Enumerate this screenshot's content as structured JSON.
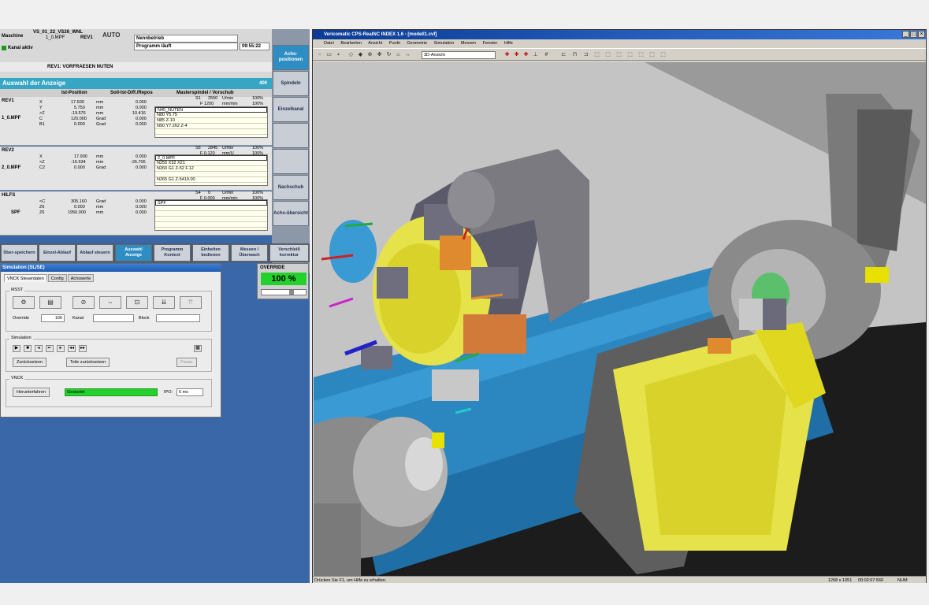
{
  "hmi": {
    "machine_label": "Maschine",
    "program_path": "VS_01_22_VS26_WNL",
    "program_file": "1_0.MPF",
    "channel": "REV1",
    "mode": "AUTO",
    "channel_state": "Kanal aktiv",
    "state_row1": "Nennbetrieb",
    "state_row2": "Programm läuft",
    "time": "09:55:22",
    "block_line": "REV1: VORFRAESEN NUTEN",
    "title": "Auswahl der Anzeige",
    "title_num": "400",
    "col_headers": [
      "Ist-Position",
      "Soll-Ist-Diff./Repos",
      "Masterspindel / Vorschub"
    ],
    "channels": [
      {
        "name": "REV1",
        "program": "1_0.MPF",
        "axes": [
          {
            "axis": "X",
            "pos": "17.500",
            "unit": "mm",
            "diff": "0.000"
          },
          {
            "axis": "Y",
            "pos": "5.750",
            "unit": "mm",
            "diff": "0.000"
          },
          {
            "axis": ">Z",
            "pos": "-19.576",
            "unit": "mm",
            "diff": "10.416"
          },
          {
            "axis": "C",
            "pos": "120.000",
            "unit": "Grad",
            "diff": "0.000"
          },
          {
            "axis": "B1",
            "pos": "0.000",
            "unit": "Grad",
            "diff": "0.000"
          }
        ],
        "spindle": {
          "s": "S1",
          "rpm": "2550",
          "unit": "U/min",
          "pct": "100%",
          "feed": "F 1200",
          "funit": "mm/min",
          "fpct": "100%"
        },
        "nc": [
          "N45_NUTEN",
          "N80 Y5.75",
          "N85 Z-10",
          "N90 Y7.262 Z-4",
          "",
          ""
        ]
      },
      {
        "name": "REV2",
        "program": "2_0.MPF",
        "axes": [
          {
            "axis": "X",
            "pos": "17.900",
            "unit": "mm",
            "diff": "0.000"
          },
          {
            "axis": "<Z",
            "pos": "-16.534",
            "unit": "mm",
            "diff": "-26.706"
          },
          {
            "axis": "C2",
            "pos": "0.000",
            "unit": "Grad",
            "diff": "0.000"
          }
        ],
        "spindle": {
          "s": "S5",
          "rpm": "2845",
          "unit": "U/min",
          "pct": "100%",
          "feed": "F 0.120",
          "funit": "mm/U",
          "fpct": "100%"
        },
        "nc": [
          "2_0.MPF",
          "N255 X32 X21",
          "N260 G1 Z-52 F.12",
          "",
          "N265 G1 Z-5419.00"
        ]
      },
      {
        "name": "HILFS",
        "program": "SPF",
        "axes": [
          {
            "axis": "<C",
            "pos": "305.160",
            "unit": "Grad",
            "diff": "0.000"
          },
          {
            "axis": "Z6",
            "pos": "0.000",
            "unit": "mm",
            "diff": "0.000"
          },
          {
            "axis": "Z6",
            "pos": "1950.000",
            "unit": "mm",
            "diff": "0.000"
          }
        ],
        "spindle": {
          "s": "S4",
          "rpm": "0",
          "unit": "U/min",
          "pct": "100%",
          "feed": "F 0.000",
          "funit": "mm/min",
          "fpct": "100%"
        },
        "nc": [
          "SPF",
          "",
          "",
          "",
          ""
        ]
      }
    ],
    "vsoft": [
      "Achs-positionen",
      "Spindeln",
      "Einzelkanal",
      "",
      "",
      "Nachschub",
      "Achs-übersicht",
      ""
    ],
    "hsoft": [
      "Über-speichern",
      "Einzel-Ablauf",
      "Ablauf steuern",
      "Auswahl Anzeige",
      "Programm Kontext",
      "Einheiten bedienen",
      "Messen / Überwach",
      "Verschleiß korrektur"
    ],
    "override_label": "OVERRIDE",
    "override_value": "100 %",
    "override_level": 0.7
  },
  "sim": {
    "title": "Simulation (SL/SE)",
    "tabs": [
      "VNCK Steuerdaten",
      "Config",
      "Achswerte"
    ],
    "group_msst": "MSST",
    "tool_icons": [
      "⚙",
      "▤",
      "⊘",
      "⇔",
      "⊡",
      "⇊",
      "⇈"
    ],
    "override_label": "Override",
    "override_value": "100",
    "kanal_label": "Kanal",
    "block_label": "Block",
    "group_sim": "Simulation",
    "play_icons": [
      "▶",
      "■",
      "◂",
      "⇤",
      "▸",
      "◂◂",
      "▸▸"
    ],
    "reset_btn": "Zurücksetzen",
    "reset_all_btn": "Teile zurücksetzen",
    "pause_btn": "Pause",
    "group_vnck": "VNCK",
    "vnck_btn": "Herunterfahren",
    "vnck_status": "Gestartet",
    "ipo_label": "IPO:",
    "ipo_value": "6 ms"
  },
  "cad": {
    "title": "Vericomatic CPS-RealNC INDEX 1.6 - [modell1.cvf]",
    "menu": [
      "Datei",
      "Bearbeiten",
      "Ansicht",
      "Punkt",
      "Geometrie",
      "Simulation",
      "Messen",
      "Fenster",
      "Hilfe"
    ],
    "view_select": "3D-Ansicht",
    "status_left": "Drücken Sie F1, um Hilfe zu erhalten.",
    "status_res": "1268 x 1051",
    "status_time": "00:02:07.560",
    "status_num": "NUM"
  }
}
